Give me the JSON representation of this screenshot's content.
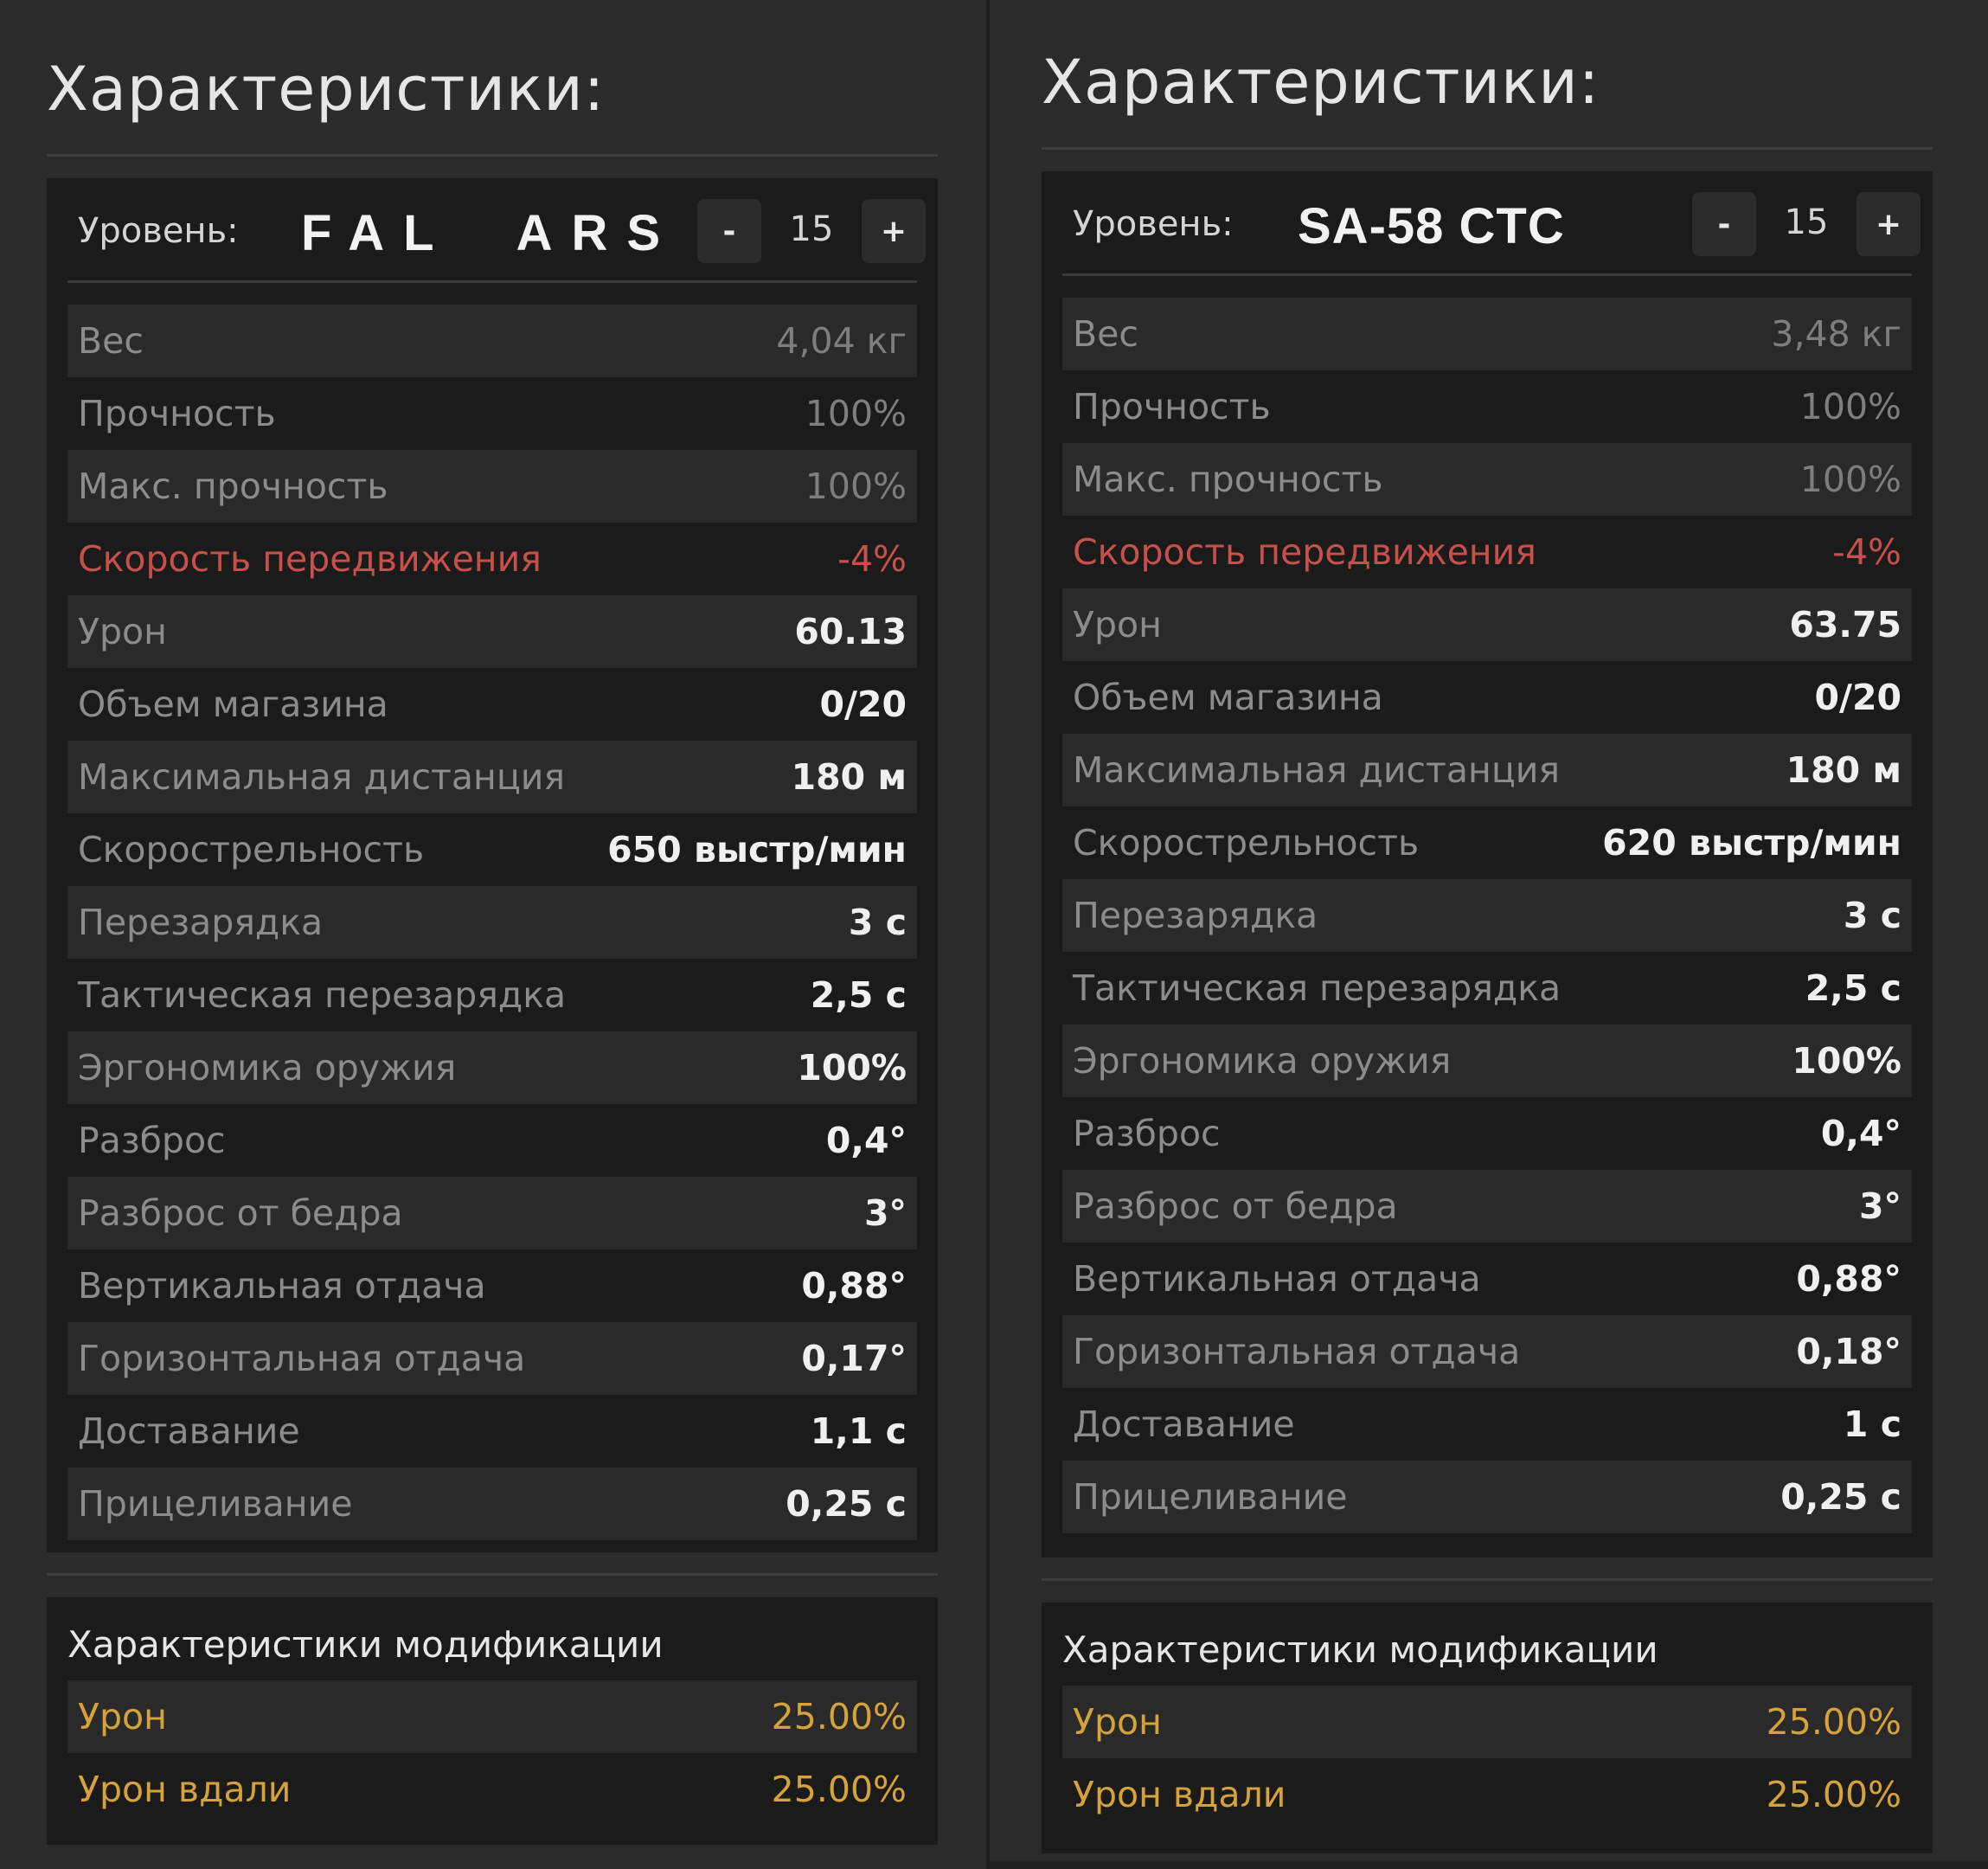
{
  "panels": [
    {
      "heading": "Характеристики:",
      "level_label": "Уровень:",
      "weapon_name": "FAL  ARS",
      "level_minus": "-",
      "level_value": "15",
      "level_plus": "+",
      "stats": [
        {
          "label": "Вес",
          "value": "4,04 кг"
        },
        {
          "label": "Прочность",
          "value": "100%"
        },
        {
          "label": "Макс. прочность",
          "value": "100%"
        },
        {
          "label": "Скорость передвижения",
          "value": "-4%"
        },
        {
          "label": "Урон",
          "value": "60.13"
        },
        {
          "label": "Объем магазина",
          "value": "0/20"
        },
        {
          "label": "Максимальная дистанция",
          "value": "180 м"
        },
        {
          "label": "Скорострельность",
          "value": "650 выстр/мин"
        },
        {
          "label": "Перезарядка",
          "value": "3 с"
        },
        {
          "label": "Тактическая перезарядка",
          "value": "2,5 с"
        },
        {
          "label": "Эргономика оружия",
          "value": "100%"
        },
        {
          "label": "Разброс",
          "value": "0,4°"
        },
        {
          "label": "Разброс от бедра",
          "value": "3°"
        },
        {
          "label": "Вертикальная отдача",
          "value": "0,88°"
        },
        {
          "label": "Горизонтальная отдача",
          "value": "0,17°"
        },
        {
          "label": "Доставание",
          "value": "1,1 с"
        },
        {
          "label": "Прицеливание",
          "value": "0,25 с"
        }
      ],
      "mod_title": "Характеристики модификации",
      "mods": [
        {
          "label": "Урон",
          "value": "25.00%"
        },
        {
          "label": "Урон вдали",
          "value": "25.00%"
        }
      ]
    },
    {
      "heading": "Характеристики:",
      "level_label": "Уровень:",
      "weapon_name": "SA-58 CTC",
      "level_minus": "-",
      "level_value": "15",
      "level_plus": "+",
      "stats": [
        {
          "label": "Вес",
          "value": "3,48 кг"
        },
        {
          "label": "Прочность",
          "value": "100%"
        },
        {
          "label": "Макс. прочность",
          "value": "100%"
        },
        {
          "label": "Скорость передвижения",
          "value": "-4%"
        },
        {
          "label": "Урон",
          "value": "63.75"
        },
        {
          "label": "Объем магазина",
          "value": "0/20"
        },
        {
          "label": "Максимальная дистанция",
          "value": "180 м"
        },
        {
          "label": "Скорострельность",
          "value": "620 выстр/мин"
        },
        {
          "label": "Перезарядка",
          "value": "3 с"
        },
        {
          "label": "Тактическая перезарядка",
          "value": "2,5 с"
        },
        {
          "label": "Эргономика оружия",
          "value": "100%"
        },
        {
          "label": "Разброс",
          "value": "0,4°"
        },
        {
          "label": "Разброс от бедра",
          "value": "3°"
        },
        {
          "label": "Вертикальная отдача",
          "value": "0,88°"
        },
        {
          "label": "Горизонтальная отдача",
          "value": "0,18°"
        },
        {
          "label": "Доставание",
          "value": "1 с"
        },
        {
          "label": "Прицеливание",
          "value": "0,25 с"
        }
      ],
      "mod_title": "Характеристики модификации",
      "mods": [
        {
          "label": "Урон",
          "value": "25.00%"
        },
        {
          "label": "Урон вдали",
          "value": "25.00%"
        }
      ]
    }
  ],
  "colors": {
    "negative": "#c8504a",
    "mod": "#d6a23a",
    "value": "#f0f0f0",
    "label": "#8c8c8c"
  }
}
